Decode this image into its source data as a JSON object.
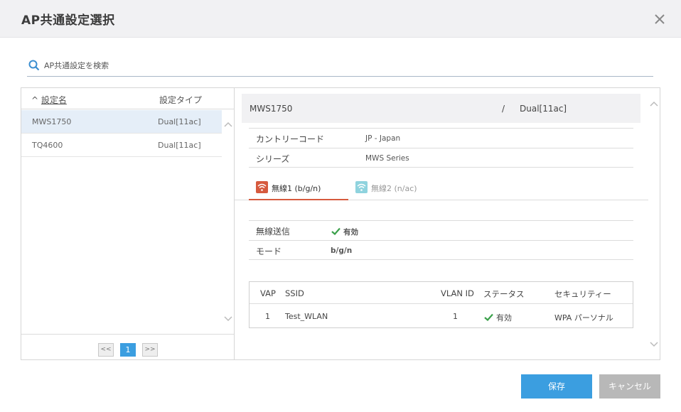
{
  "dialog": {
    "title": "AP共通設定選択",
    "close_icon": "close-icon"
  },
  "search": {
    "placeholder": "AP共通設定を検索",
    "value": ""
  },
  "list": {
    "columns": {
      "name_sort_indicator": "^",
      "name": "設定名",
      "type": "設定タイプ"
    },
    "rows": [
      {
        "name": "MWS1750",
        "type": "Dual[11ac]"
      },
      {
        "name": "TQ4600",
        "type": "Dual[11ac]"
      }
    ],
    "pager": {
      "prev": "<<",
      "current": "1",
      "next": ">>"
    }
  },
  "detail": {
    "name": "MWS1750",
    "separator": "/",
    "type": "Dual[11ac]",
    "fields": [
      {
        "label": "カントリーコード",
        "value": "JP - Japan"
      },
      {
        "label": "シリーズ",
        "value": "MWS Series"
      }
    ],
    "tabs": [
      {
        "label": "無線1 (b/g/n)",
        "active": true,
        "icon": "wifi-icon"
      },
      {
        "label": "無線2 (n/ac)",
        "active": false,
        "icon": "wifi-icon"
      }
    ],
    "radio": [
      {
        "label": "無線送信",
        "value": "有効"
      },
      {
        "label": "モード",
        "value": "b/g/n"
      }
    ],
    "vap_table": {
      "headers": [
        "VAP",
        "SSID",
        "VLAN ID",
        "ステータス",
        "セキュリティー"
      ],
      "rows": [
        {
          "vap": "1",
          "ssid": "Test_WLAN",
          "vlan": "1",
          "status": "有効",
          "security": "WPA パーソナル"
        }
      ]
    }
  },
  "buttons": {
    "save": "保存",
    "cancel": "キャンセル"
  },
  "colors": {
    "accent": "#3b9ee0",
    "tab_active": "#d65a3e",
    "tab_inactive": "#8fd3de",
    "check": "#3aa04a"
  }
}
